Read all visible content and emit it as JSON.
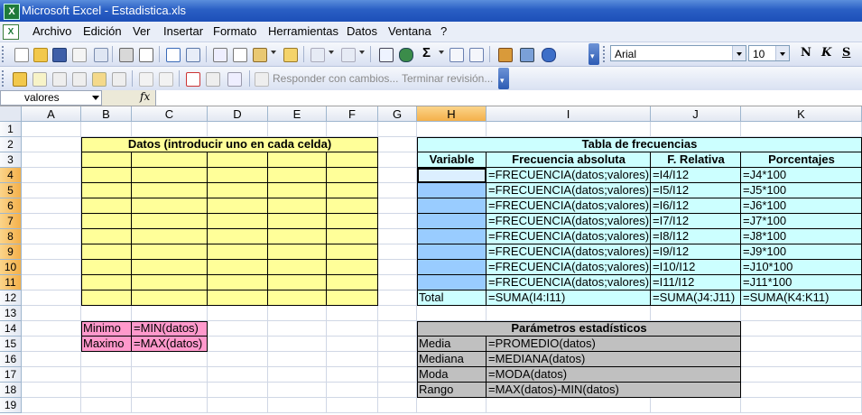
{
  "window": {
    "title": "Microsoft Excel - Estadistica.xls"
  },
  "menu": [
    "Archivo",
    "Edición",
    "Ver",
    "Insertar",
    "Formato",
    "Herramientas",
    "Datos",
    "Ventana",
    "?"
  ],
  "toolbar": {
    "font_name": "Arial",
    "font_size": "10",
    "bold_label": "N",
    "italic_label": "K",
    "underline_label": "S",
    "sigma": "Σ",
    "responder": "Responder con cambios...",
    "terminar": "Terminar revisión..."
  },
  "formula_bar": {
    "name_box": "valores",
    "fx": "fx",
    "content": ""
  },
  "columns": [
    "A",
    "B",
    "C",
    "D",
    "E",
    "F",
    "G",
    "H",
    "I",
    "J",
    "K"
  ],
  "rows": [
    "1",
    "2",
    "3",
    "4",
    "5",
    "6",
    "7",
    "8",
    "9",
    "10",
    "11",
    "12",
    "13",
    "14",
    "15",
    "16",
    "17",
    "18",
    "19"
  ],
  "datos_header": "Datos (introducir uno en cada celda)",
  "minmax": [
    {
      "label": "Minimo",
      "formula": "=MIN(datos)"
    },
    {
      "label": "Maximo",
      "formula": "=MAX(datos)"
    }
  ],
  "freq_table": {
    "title": "Tabla de frecuencias",
    "headers": [
      "Variable",
      "Frecuencia absoluta",
      "F. Relativa",
      "Porcentajes"
    ],
    "rows": [
      {
        "abs": "=FRECUENCIA(datos;valores)",
        "rel": "=I4/I12",
        "pct": "=J4*100"
      },
      {
        "abs": "=FRECUENCIA(datos;valores)",
        "rel": "=I5/I12",
        "pct": "=J5*100"
      },
      {
        "abs": "=FRECUENCIA(datos;valores)",
        "rel": "=I6/I12",
        "pct": "=J6*100"
      },
      {
        "abs": "=FRECUENCIA(datos;valores)",
        "rel": "=I7/I12",
        "pct": "=J7*100"
      },
      {
        "abs": "=FRECUENCIA(datos;valores)",
        "rel": "=I8/I12",
        "pct": "=J8*100"
      },
      {
        "abs": "=FRECUENCIA(datos;valores)",
        "rel": "=I9/I12",
        "pct": "=J9*100"
      },
      {
        "abs": "=FRECUENCIA(datos;valores)",
        "rel": "=I10/I12",
        "pct": "=J10*100"
      },
      {
        "abs": "=FRECUENCIA(datos;valores)",
        "rel": "=I11/I12",
        "pct": "=J11*100"
      }
    ],
    "total": {
      "label": "Total",
      "abs": "=SUMA(I4:I11)",
      "rel": "=SUMA(J4:J11)",
      "pct": "=SUMA(K4:K11)"
    }
  },
  "params": {
    "title": "Parámetros estadísticos",
    "rows": [
      {
        "label": "Media",
        "formula": "=PROMEDIO(datos)"
      },
      {
        "label": "Mediana",
        "formula": "=MEDIANA(datos)"
      },
      {
        "label": "Moda",
        "formula": "=MODA(datos)"
      },
      {
        "label": "Rango",
        "formula": "=MAX(datos)-MIN(datos)"
      }
    ]
  },
  "colors": {
    "yellow": "#ffff99",
    "cyan": "#ccffff",
    "blue_selected": "#99ccff",
    "pink": "#ff99cc",
    "gray": "#c0c0c0"
  }
}
